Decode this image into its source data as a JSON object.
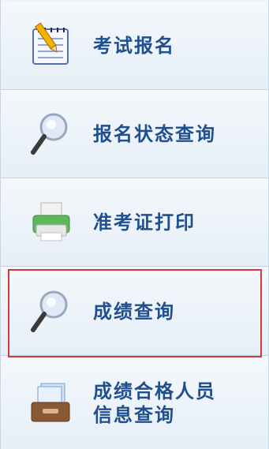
{
  "menu": {
    "items": [
      {
        "label": "考试报名",
        "icon": "notepad-pencil-icon"
      },
      {
        "label": "报名状态查询",
        "icon": "magnifier-icon"
      },
      {
        "label": "准考证打印",
        "icon": "printer-icon"
      },
      {
        "label": "成绩查询",
        "icon": "magnifier-icon"
      },
      {
        "label_line1": "成绩合格人员",
        "label_line2": "信息查询",
        "icon": "file-tray-icon"
      }
    ]
  },
  "colors": {
    "label": "#1f4f8c",
    "highlight_border": "#d23b3b",
    "item_bg": "#eef3f9"
  }
}
